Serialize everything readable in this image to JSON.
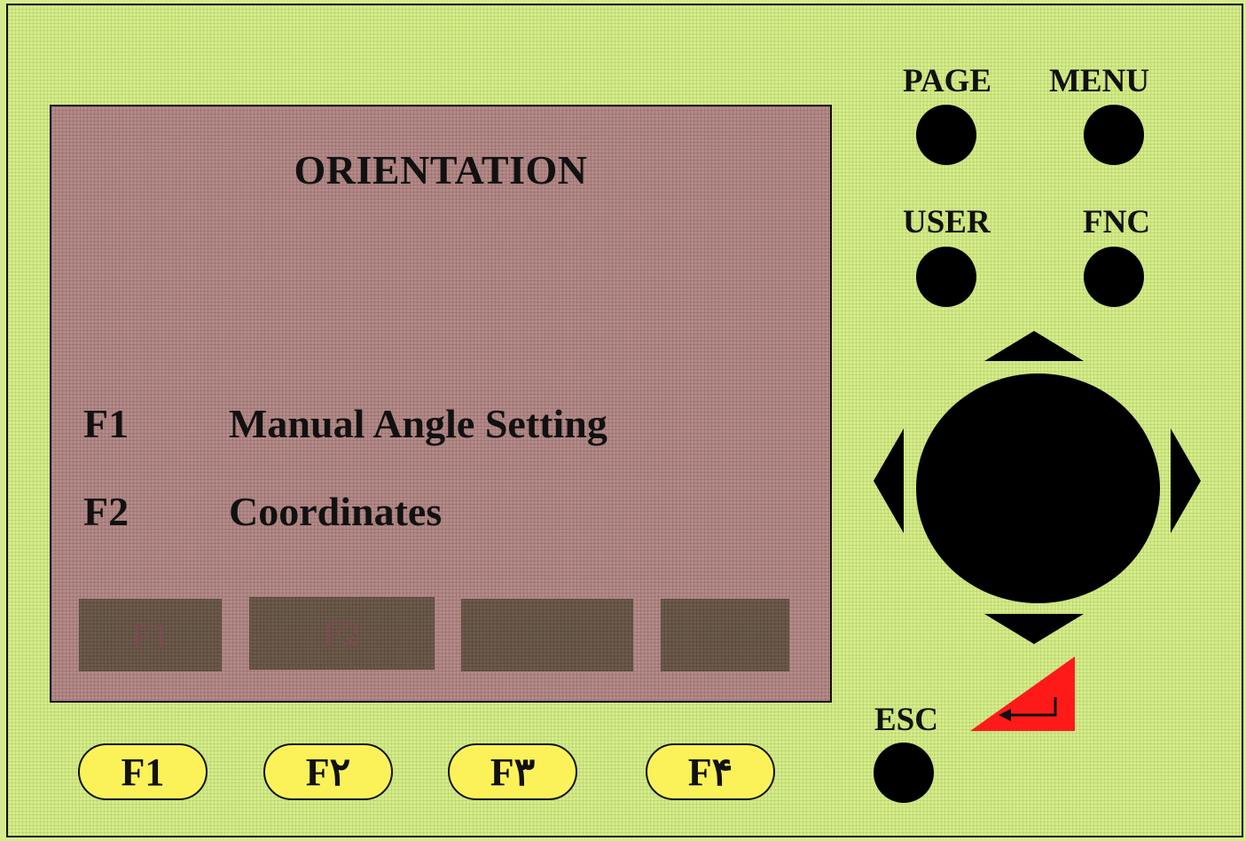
{
  "screen": {
    "title": "ORIENTATION",
    "menu": [
      {
        "key": "F1",
        "label": "Manual Angle Setting"
      },
      {
        "key": "F2",
        "label": "Coordinates"
      }
    ],
    "softkeys": [
      "F1",
      "F2",
      "",
      ""
    ]
  },
  "keypad": {
    "page_label": "PAGE",
    "menu_label": "MENU",
    "user_label": "USER",
    "fnc_label": "FNC",
    "esc_label": "ESC"
  },
  "function_keys": [
    "F1",
    "F۲",
    "F۳",
    "F۴"
  ],
  "icons": {
    "navigation": [
      "up-arrow-icon",
      "down-arrow-icon",
      "left-arrow-icon",
      "right-arrow-icon"
    ],
    "enter": "enter-return-icon"
  },
  "colors": {
    "panel_background": "#d6ec8c",
    "screen_background": "#b48a88",
    "softkey_background": "#6c5a4a",
    "function_key_fill": "#fbf25a",
    "button": "#000000",
    "enter_key": "#ff1a1a"
  }
}
